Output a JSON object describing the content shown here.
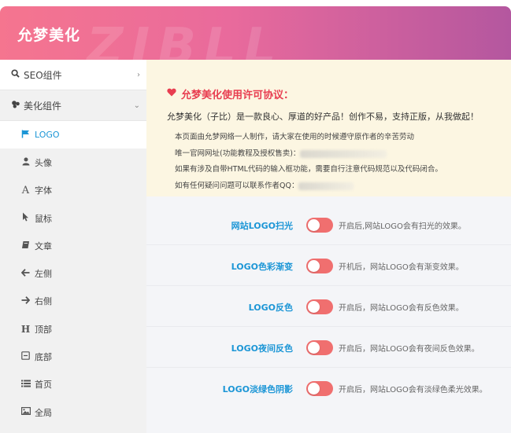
{
  "header": {
    "title": "允梦美化",
    "watermark": "ZIBLL"
  },
  "sidebar": {
    "groups": [
      {
        "label": "SEO组件",
        "icon": "search-icon",
        "arrow": "›"
      },
      {
        "label": "美化组件",
        "icon": "palette-icon",
        "arrow": "⌄"
      }
    ],
    "items": [
      {
        "label": "LOGO",
        "icon": "flag-icon",
        "active": true
      },
      {
        "label": "头像",
        "icon": "user-icon"
      },
      {
        "label": "字体",
        "icon": "font-icon"
      },
      {
        "label": "鼠标",
        "icon": "cursor-icon"
      },
      {
        "label": "文章",
        "icon": "book-icon"
      },
      {
        "label": "左侧",
        "icon": "arrow-left-icon"
      },
      {
        "label": "右侧",
        "icon": "arrow-right-icon"
      },
      {
        "label": "顶部",
        "icon": "header-icon"
      },
      {
        "label": "底部",
        "icon": "footer-icon"
      },
      {
        "label": "首页",
        "icon": "list-icon"
      },
      {
        "label": "全局",
        "icon": "image-icon"
      }
    ]
  },
  "notice": {
    "title": "允梦美化使用许可协议：",
    "intro": "允梦美化（子比）是一款良心、厚道的好产品！创作不易，支持正版，从我做起！",
    "lines": [
      "本页面由允梦网络一人制作，请大家在使用的时候遵守原作者的辛苦劳动",
      "唯一官网网址(功能教程及授权售卖)：",
      "如果有涉及自带HTML代码的输入框功能，需要自行注意代码规范以及代码闭合。",
      "如有任何疑问问题可以联系作者QQ："
    ]
  },
  "options": [
    {
      "label": "网站LOGO扫光",
      "desc": "开启后,网站LOGO会有扫光的效果。",
      "enabled": false
    },
    {
      "label": "LOGO色彩渐变",
      "desc": "开机后，网站LOGO会有渐变效果。",
      "enabled": false
    },
    {
      "label": "LOGO反色",
      "desc": "开启后，网站LOGO会有反色效果。",
      "enabled": false
    },
    {
      "label": "LOGO夜间反色",
      "desc": "开启后，网站LOGO会有夜间反色效果。",
      "enabled": false
    },
    {
      "label": "LOGO淡绿色阴影",
      "desc": "开启后，网站LOGO会有淡绿色柔光效果。",
      "enabled": false
    }
  ],
  "colors": {
    "accent_blue": "#1c96d6",
    "toggle": "#f06f6f",
    "notice_title": "#e83d50",
    "notice_bg": "#fcf6e2"
  }
}
